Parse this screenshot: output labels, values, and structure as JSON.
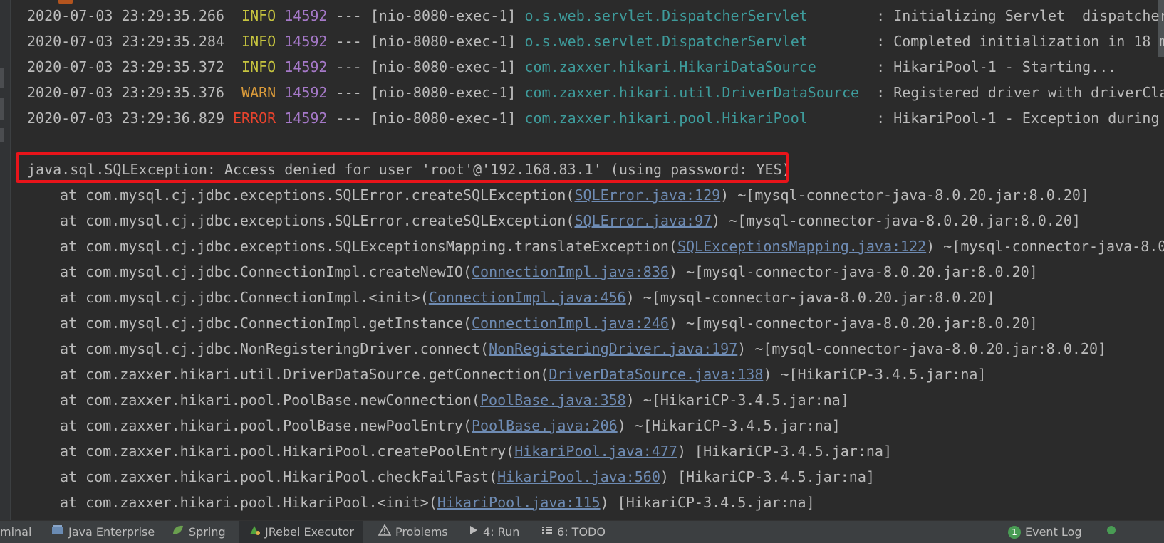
{
  "log_lines": [
    {
      "ts": "2020-07-03 23:29:35.266",
      "level": "INFO",
      "pid": "14592",
      "sep": "---",
      "thread": "[nio-8080-exec-1]",
      "logger": "o.s.web.servlet.DispatcherServlet",
      "message": ": Initializing Servlet  dispatcher"
    },
    {
      "ts": "2020-07-03 23:29:35.284",
      "level": "INFO",
      "pid": "14592",
      "sep": "---",
      "thread": "[nio-8080-exec-1]",
      "logger": "o.s.web.servlet.DispatcherServlet",
      "message": ": Completed initialization in 18 m"
    },
    {
      "ts": "2020-07-03 23:29:35.372",
      "level": "INFO",
      "pid": "14592",
      "sep": "---",
      "thread": "[nio-8080-exec-1]",
      "logger": "com.zaxxer.hikari.HikariDataSource",
      "message": ": HikariPool-1 - Starting..."
    },
    {
      "ts": "2020-07-03 23:29:35.376",
      "level": "WARN",
      "pid": "14592",
      "sep": "---",
      "thread": "[nio-8080-exec-1]",
      "logger": "com.zaxxer.hikari.util.DriverDataSource",
      "message": ": Registered driver with driverCla"
    },
    {
      "ts": "2020-07-03 23:29:36.829",
      "level": "ERROR",
      "pid": "14592",
      "sep": "---",
      "thread": "[nio-8080-exec-1]",
      "logger": "com.zaxxer.hikari.pool.HikariPool",
      "message": ": HikariPool-1 - Exception during"
    }
  ],
  "exception_line": "java.sql.SQLException: Access denied for user 'root'@'192.168.83.1' (using password: YES)",
  "stack_frames": [
    {
      "prefix": "at com.mysql.cj.jdbc.exceptions.SQLError.createSQLException",
      "loc": "SQLError.java:129",
      "suffix": " ~[mysql-connector-java-8.0.20.jar:8.0.20]"
    },
    {
      "prefix": "at com.mysql.cj.jdbc.exceptions.SQLError.createSQLException",
      "loc": "SQLError.java:97",
      "suffix": " ~[mysql-connector-java-8.0.20.jar:8.0.20]"
    },
    {
      "prefix": "at com.mysql.cj.jdbc.exceptions.SQLExceptionsMapping.translateException",
      "loc": "SQLExceptionsMapping.java:122",
      "suffix": " ~[mysql-connector-java-8.0"
    },
    {
      "prefix": "at com.mysql.cj.jdbc.ConnectionImpl.createNewIO",
      "loc": "ConnectionImpl.java:836",
      "suffix": " ~[mysql-connector-java-8.0.20.jar:8.0.20]"
    },
    {
      "prefix": "at com.mysql.cj.jdbc.ConnectionImpl.<init>",
      "loc": "ConnectionImpl.java:456",
      "suffix": " ~[mysql-connector-java-8.0.20.jar:8.0.20]"
    },
    {
      "prefix": "at com.mysql.cj.jdbc.ConnectionImpl.getInstance",
      "loc": "ConnectionImpl.java:246",
      "suffix": " ~[mysql-connector-java-8.0.20.jar:8.0.20]"
    },
    {
      "prefix": "at com.mysql.cj.jdbc.NonRegisteringDriver.connect",
      "loc": "NonRegisteringDriver.java:197",
      "suffix": " ~[mysql-connector-java-8.0.20.jar:8.0.20]"
    },
    {
      "prefix": "at com.zaxxer.hikari.util.DriverDataSource.getConnection",
      "loc": "DriverDataSource.java:138",
      "suffix": " ~[HikariCP-3.4.5.jar:na]"
    },
    {
      "prefix": "at com.zaxxer.hikari.pool.PoolBase.newConnection",
      "loc": "PoolBase.java:358",
      "suffix": " ~[HikariCP-3.4.5.jar:na]"
    },
    {
      "prefix": "at com.zaxxer.hikari.pool.PoolBase.newPoolEntry",
      "loc": "PoolBase.java:206",
      "suffix": " ~[HikariCP-3.4.5.jar:na]"
    },
    {
      "prefix": "at com.zaxxer.hikari.pool.HikariPool.createPoolEntry",
      "loc": "HikariPool.java:477",
      "suffix": " [HikariCP-3.4.5.jar:na]"
    },
    {
      "prefix": "at com.zaxxer.hikari.pool.HikariPool.checkFailFast",
      "loc": "HikariPool.java:560",
      "suffix": " [HikariCP-3.4.5.jar:na]"
    },
    {
      "prefix": "at com.zaxxer.hikari.pool.HikariPool.<init>",
      "loc": "HikariPool.java:115",
      "suffix": " [HikariCP-3.4.5.jar:na]"
    }
  ],
  "statusbar": {
    "terminal": "minal",
    "java_enterprise": "Java Enterprise",
    "spring": "Spring",
    "jrebel": "JRebel Executor",
    "problems": "Problems",
    "run_num": "4",
    "run_label": ": Run",
    "todo_num": "6",
    "todo_label": ": TODO",
    "event_log": "Event Log",
    "event_count": "1"
  },
  "icons": {
    "java_enterprise": "java-enterprise-icon",
    "spring": "spring-leaf-icon",
    "jrebel": "jrebel-icon",
    "problems": "warning-triangle-icon",
    "run": "run-triangle-icon",
    "todo": "todo-list-icon",
    "event_log": "event-log-icon"
  },
  "colors": {
    "background": "#2b2b2b",
    "info": "#c6c43f",
    "warn": "#d99a3a",
    "error": "#e8432d",
    "pid": "#a679c9",
    "logger": "#3e9b9b",
    "highlight_border": "#e8141a"
  }
}
